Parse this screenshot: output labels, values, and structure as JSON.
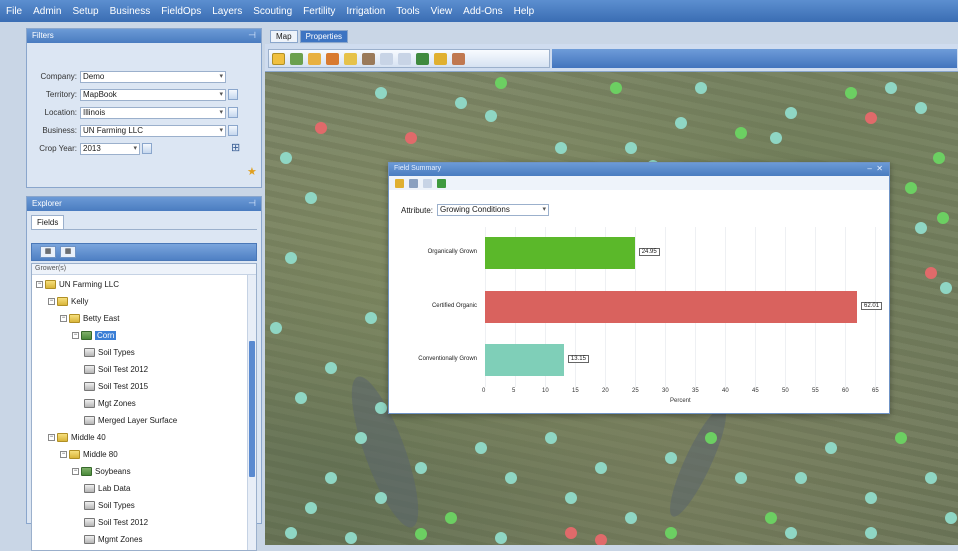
{
  "menu": [
    "File",
    "Admin",
    "Setup",
    "Business",
    "FieldOps",
    "Layers",
    "Scouting",
    "Fertility",
    "Irrigation",
    "Tools",
    "View",
    "Add-Ons",
    "Help"
  ],
  "filter_panel": {
    "title": "Filters",
    "fields": [
      {
        "label": "Company:",
        "value": "Demo"
      },
      {
        "label": "Territory:",
        "value": "MapBook"
      },
      {
        "label": "Location:",
        "value": "Illinois"
      },
      {
        "label": "Business:",
        "value": "UN Farming LLC"
      },
      {
        "label": "Crop Year:",
        "value": "2013"
      }
    ]
  },
  "tree_panel": {
    "title": "Explorer",
    "tab": "Fields",
    "header": "Grower(s)",
    "items": [
      {
        "label": "UN Farming LLC",
        "icon": "folder-icon",
        "level": 0
      },
      {
        "label": "Kelly",
        "icon": "folder-icon",
        "level": 1
      },
      {
        "label": "Betty East",
        "icon": "folder-icon",
        "level": 2
      },
      {
        "label": "Corn",
        "icon": "crop-layer-icon",
        "level": 3,
        "selected": true
      },
      {
        "label": "Soil Types",
        "icon": "layer-doc-icon",
        "level": 4
      },
      {
        "label": "Soil Test 2012",
        "icon": "layer-doc-icon",
        "level": 4
      },
      {
        "label": "Soil Test 2015",
        "icon": "layer-doc-icon",
        "level": 4
      },
      {
        "label": "Mgt Zones",
        "icon": "layer-doc-icon",
        "level": 4
      },
      {
        "label": "Merged Layer Surface",
        "icon": "layer-doc-icon",
        "level": 4
      },
      {
        "label": "Middle 40",
        "icon": "folder-icon",
        "level": 1
      },
      {
        "label": "Middle 80",
        "icon": "folder-icon",
        "level": 2
      },
      {
        "label": "Soybeans",
        "icon": "crop-layer-icon",
        "level": 3
      },
      {
        "label": "Lab Data",
        "icon": "layer-doc-icon",
        "level": 4
      },
      {
        "label": "Soil Types",
        "icon": "layer-doc-icon",
        "level": 4
      },
      {
        "label": "Soil Test 2012",
        "icon": "layer-doc-icon",
        "level": 4
      },
      {
        "label": "Mgmt Zones",
        "icon": "layer-doc-icon",
        "level": 4
      }
    ]
  },
  "map_tabs": [
    "Map",
    "Properties"
  ],
  "chart_window": {
    "title": "Field Summary",
    "attribute_label": "Attribute:",
    "attribute_value": "Growing Conditions"
  },
  "colors": {
    "accent": "#3d74c2",
    "bar_green": "#5bb82a",
    "bar_red": "#d9625e",
    "bar_teal": "#7fcfb8"
  },
  "chart_data": {
    "type": "bar",
    "orientation": "horizontal",
    "categories": [
      "Organically Grown",
      "Certified Organic",
      "Conventionally Grown"
    ],
    "values": [
      24.95,
      62.01,
      13.15
    ],
    "value_labels": [
      "24.95",
      "62.01",
      "13.15"
    ],
    "xlabel": "Percent",
    "xlim": [
      0,
      65
    ],
    "xticks": [
      0,
      5,
      10,
      15,
      20,
      25,
      30,
      35,
      40,
      45,
      50,
      55,
      60,
      65
    ],
    "grid": true
  }
}
